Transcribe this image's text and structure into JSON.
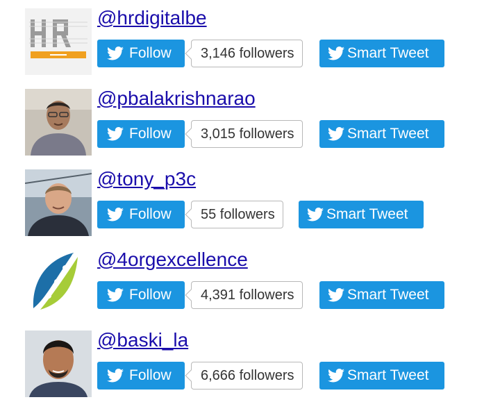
{
  "accounts": [
    {
      "handle": "@hrdigitalbe",
      "follow_label": "Follow",
      "followers": "3,146 followers",
      "smart_tweet_label": "Smart Tweet",
      "avatar_icon": "hr-logo",
      "avatar_text": "HR"
    },
    {
      "handle": "@pbalakrishnarao",
      "follow_label": "Follow",
      "followers": "3,015 followers",
      "smart_tweet_label": "Smart Tweet",
      "avatar_icon": "person-photo"
    },
    {
      "handle": "@tony_p3c",
      "follow_label": "Follow",
      "followers": "55 followers",
      "smart_tweet_label": "Smart Tweet",
      "avatar_icon": "person-photo"
    },
    {
      "handle": "@4orgexcellence",
      "follow_label": "Follow",
      "followers": "4,391 followers",
      "smart_tweet_label": "Smart Tweet",
      "avatar_icon": "leaf-logo"
    },
    {
      "handle": "@baski_la",
      "follow_label": "Follow",
      "followers": "6,666 followers",
      "smart_tweet_label": "Smart Tweet",
      "avatar_icon": "person-photo"
    }
  ],
  "colors": {
    "button": "#1b95e0",
    "link": "#1a0dab",
    "count_border": "#b8b8b8"
  },
  "icons": {
    "follow": "twitter-bird-icon",
    "smart_tweet": "twitter-bird-icon"
  }
}
